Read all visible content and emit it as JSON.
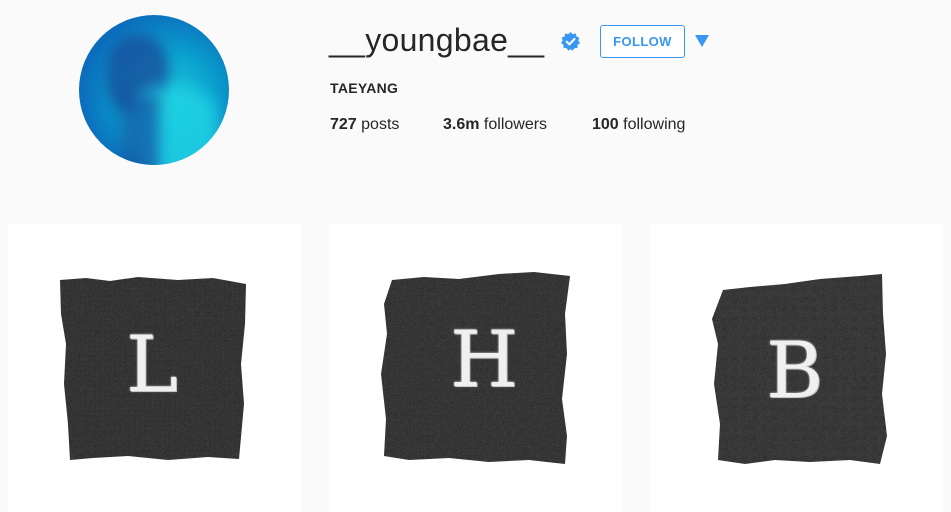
{
  "profile": {
    "username": "__youngbae__",
    "verified": true,
    "full_name": "TAEYANG",
    "follow_label": "FOLLOW",
    "stats": {
      "posts_count": "727",
      "posts_label": "posts",
      "followers_count": "3.6m",
      "followers_label": "followers",
      "following_count": "100",
      "following_label": "following"
    }
  },
  "colors": {
    "accent": "#3897f0",
    "background": "#fafafa"
  },
  "icons": {
    "verified": "verified-badge-icon",
    "dropdown": "triangle-down-icon"
  },
  "posts": [
    {
      "letter": "L"
    },
    {
      "letter": "H"
    },
    {
      "letter": "B"
    }
  ]
}
